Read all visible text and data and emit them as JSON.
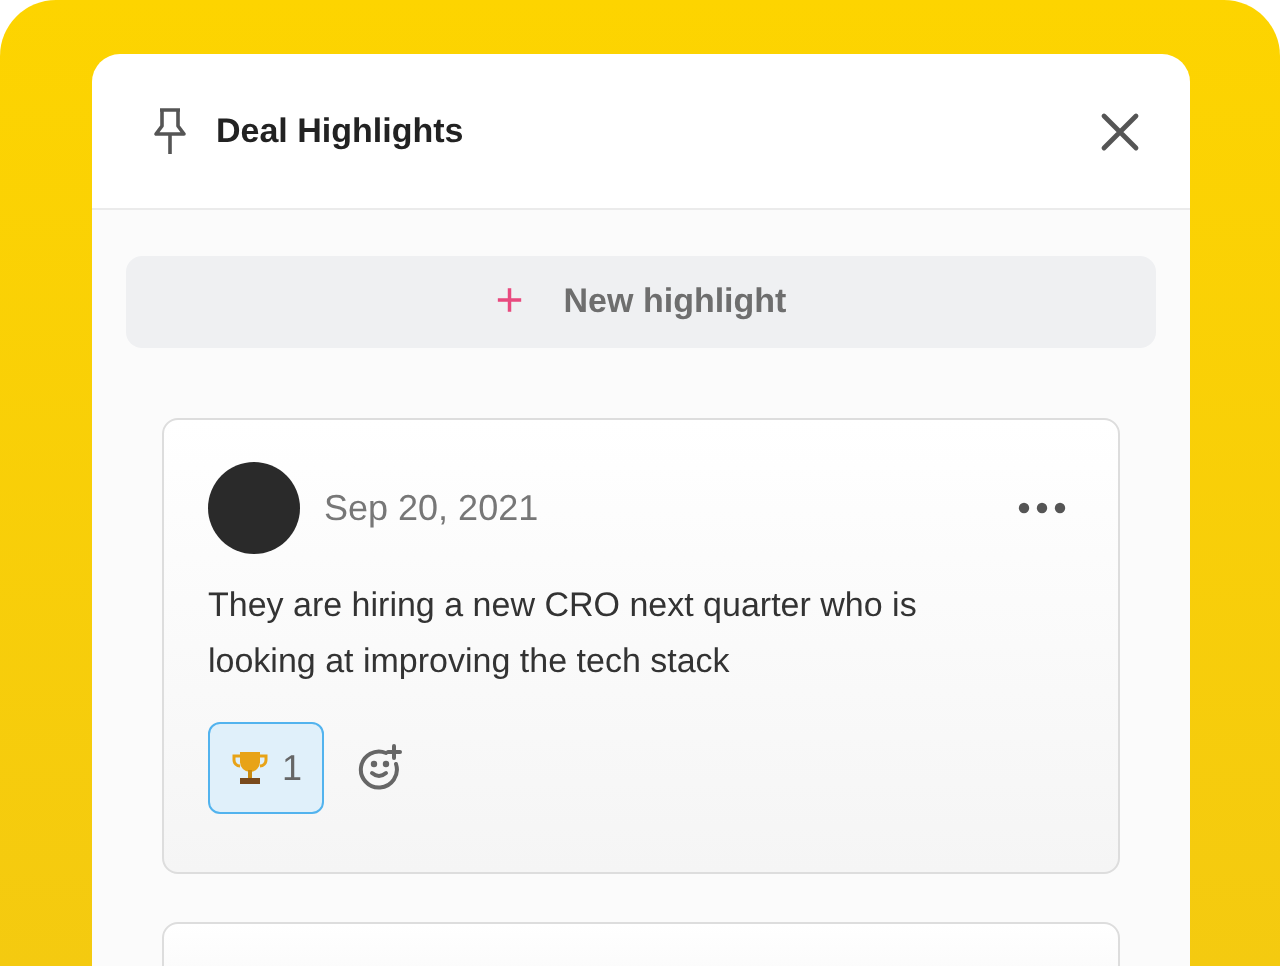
{
  "panel": {
    "title": "Deal Highlights"
  },
  "new_button": {
    "icon": "+",
    "label": "New highlight"
  },
  "highlights": [
    {
      "date": "Sep 20, 2021",
      "text": "They are hiring a new CRO next quarter who is looking at improving the tech stack",
      "reactions": [
        {
          "count": "1",
          "selected": true
        }
      ]
    }
  ]
}
